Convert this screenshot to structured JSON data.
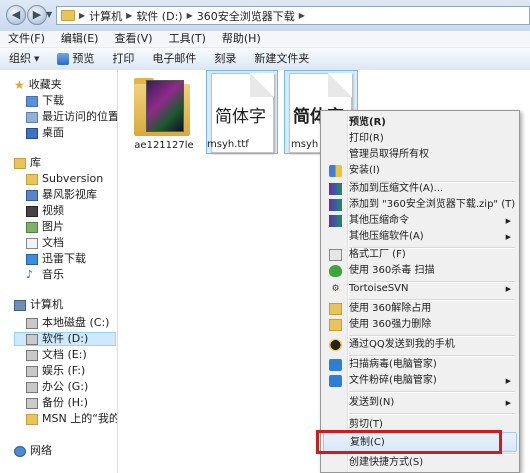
{
  "address": {
    "crumbs": [
      "计算机",
      "软件 (D:)",
      "360安全浏览器下载"
    ]
  },
  "menubar": [
    "文件(F)",
    "编辑(E)",
    "查看(V)",
    "工具(T)",
    "帮助(H)"
  ],
  "toolbar": {
    "organize": "组织",
    "preview": "预览",
    "print": "打印",
    "email": "电子邮件",
    "burn": "刻录",
    "new_folder": "新建文件夹"
  },
  "nav": {
    "favorites": "收藏夹",
    "fav_items": [
      "下载",
      "最近访问的位置",
      "桌面"
    ],
    "libraries": "库",
    "lib_items": [
      "Subversion",
      "暴风影视库",
      "视频",
      "图片",
      "文档",
      "迅雷下载",
      "音乐"
    ],
    "computer": "计算机",
    "drives": [
      "本地磁盘 (C:)",
      "软件 (D:)",
      "文档 (E:)",
      "娱乐 (F:)",
      "办公 (G:)",
      "备份 (H:)",
      "MSN 上的“我的网"
    ],
    "network": "网络"
  },
  "files": [
    {
      "name": "ae121127le"
    },
    {
      "name": "msyh.ttf",
      "glyph": "简体字"
    },
    {
      "name": "msyh",
      "glyph": "简体字"
    }
  ],
  "context_menu": [
    {
      "label": "预览(R)",
      "bold": true
    },
    {
      "label": "打印(R)"
    },
    {
      "label": "管理员取得所有权"
    },
    {
      "label": "安装(I)"
    },
    {
      "label": "添加到压缩文件(A)..."
    },
    {
      "label": "添加到 \"360安全浏览器下载.zip\" (T)"
    },
    {
      "label": "其他压缩命令"
    },
    {
      "label": "其他压缩软件(A)"
    },
    {
      "label": "格式工厂 (F)"
    },
    {
      "label": "使用 360杀毒 扫描"
    },
    {
      "label": "TortoiseSVN"
    },
    {
      "label": "使用 360解除占用"
    },
    {
      "label": "使用 360强力删除"
    },
    {
      "label": "通过QQ发送到我的手机"
    },
    {
      "label": "扫描病毒(电脑管家)"
    },
    {
      "label": "文件粉碎(电脑管家)"
    },
    {
      "label": "发送到(N)"
    },
    {
      "label": "剪切(T)"
    },
    {
      "label": "复制(C)"
    },
    {
      "label": "创建快捷方式(S)"
    }
  ],
  "colors": {
    "highlight": "#d11a1a",
    "selection": "#cde8ff",
    "folder": "#e9c45a"
  }
}
